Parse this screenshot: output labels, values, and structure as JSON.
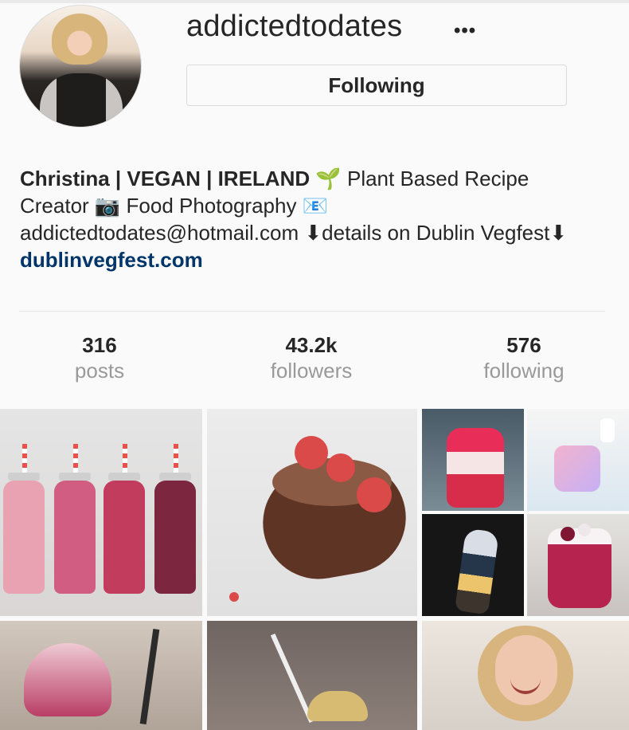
{
  "profile": {
    "username": "addictedtodates",
    "more_icon": "ellipsis-icon",
    "following_label": "Following",
    "bio": {
      "name": "Christina | VEGAN | IRELAND",
      "emoji_1": "🌱",
      "text_1": " Plant Based Recipe Creator ",
      "emoji_2": "📷",
      "text_2": " Food Photography ",
      "emoji_3": "📧",
      "text_3": " addictedtodates@hotmail.com ",
      "emoji_4": "⬇",
      "text_4": "details on Dublin Vegfest",
      "emoji_5": "⬇",
      "link": "dublinvegfest.com"
    }
  },
  "stats": {
    "posts": {
      "value": "316",
      "label": "posts"
    },
    "followers": {
      "value": "43.2k",
      "label": "followers"
    },
    "following": {
      "value": "576",
      "label": "following"
    }
  },
  "grid": {
    "tiles": [
      {
        "name": "smoothie-bottles-photo"
      },
      {
        "name": "chocolate-cake-photo"
      },
      {
        "name": "pink-jar-photo"
      },
      {
        "name": "ice-pops-photo"
      },
      {
        "name": "popsicle-photo"
      },
      {
        "name": "berry-glass-photo"
      },
      {
        "name": "pink-dessert-photo"
      },
      {
        "name": "dark-dessert-photo"
      },
      {
        "name": "profile-photo"
      }
    ]
  },
  "colors": {
    "text": "#262626",
    "link": "#003569",
    "muted": "#999999",
    "background": "#fafafa",
    "border": "#dbdbdb"
  }
}
